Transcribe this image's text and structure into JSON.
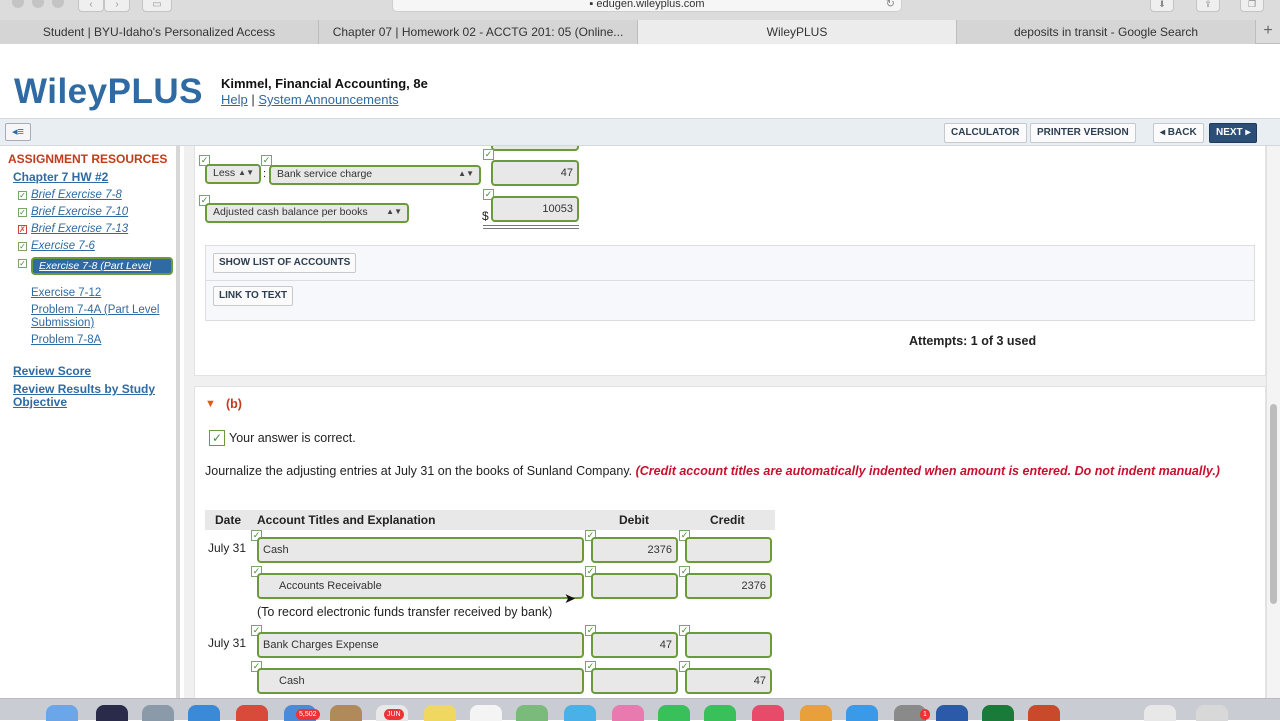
{
  "browser": {
    "url": "edugen.wileyplus.com",
    "tabs": [
      {
        "label": "Student | BYU-Idaho's Personalized Access"
      },
      {
        "label": "Chapter 07 | Homework 02 - ACCTG 201: 05 (Online..."
      },
      {
        "label": "WileyPLUS"
      },
      {
        "label": "deposits in transit - Google Search"
      }
    ],
    "new_tab": "+"
  },
  "header": {
    "logo": "WileyPLUS",
    "book_title": "Kimmel, Financial Accounting, 8e",
    "help": "Help",
    "separator": "|",
    "announcements": "System Announcements"
  },
  "toolbar": {
    "calculator": "CALCULATOR",
    "printer": "PRINTER VERSION",
    "back": "◂ BACK",
    "next": "NEXT ▸"
  },
  "sidebar": {
    "heading": "ASSIGNMENT RESOURCES",
    "chapter": "Chapter 7 HW #2",
    "items": [
      {
        "label": "Brief Exercise 7-8",
        "status": "correct"
      },
      {
        "label": "Brief Exercise 7-10",
        "status": "correct"
      },
      {
        "label": "Brief Exercise 7-13",
        "status": "incorrect"
      },
      {
        "label": "Exercise 7-6",
        "status": "correct"
      },
      {
        "label": "Exercise 7-8 (Part Level Submission)",
        "status": "correct"
      },
      {
        "label": "Exercise 7-12",
        "status": "none"
      },
      {
        "label": "Problem 7-4A (Part Level Submission)",
        "status": "none"
      },
      {
        "label": "Problem 7-8A",
        "status": "none"
      }
    ],
    "review_score": "Review Score",
    "review_results": "Review Results by Study Objective"
  },
  "part_a": {
    "less_select": "Less",
    "colon": ":",
    "bank_service_charge": "Bank service charge",
    "bank_service_charge_amount": "47",
    "adjusted_label": "Adjusted cash balance per books",
    "dollar": "$",
    "adjusted_amount": "10053",
    "show_list": "SHOW LIST OF ACCOUNTS",
    "link_to_text": "LINK TO TEXT",
    "attempts": "Attempts: 1 of 3 used"
  },
  "part_b": {
    "label": "(b)",
    "correct_msg": "Your answer is correct.",
    "instruction": "Journalize the adjusting entries at July 31 on the books of Sunland Company.",
    "instruction_note": "(Credit account titles are automatically indented when amount is entered. Do not indent manually.)",
    "columns": {
      "date": "Date",
      "account": "Account Titles and Explanation",
      "debit": "Debit",
      "credit": "Credit"
    },
    "entries": [
      {
        "date": "July 31",
        "account": "Cash",
        "debit": "2376",
        "credit": ""
      },
      {
        "date": "",
        "account": "Accounts Receivable",
        "debit": "",
        "credit": "2376"
      },
      {
        "date": "July 31",
        "account": "Bank Charges Expense",
        "debit": "47",
        "credit": ""
      },
      {
        "date": "",
        "account": "Cash",
        "debit": "",
        "credit": "47"
      }
    ],
    "explanation_1": "(To record electronic funds transfer received by bank)"
  },
  "dock": {
    "badge_mail": "5,502",
    "badge_calendar": "JUN",
    "badge_notif": "1"
  }
}
